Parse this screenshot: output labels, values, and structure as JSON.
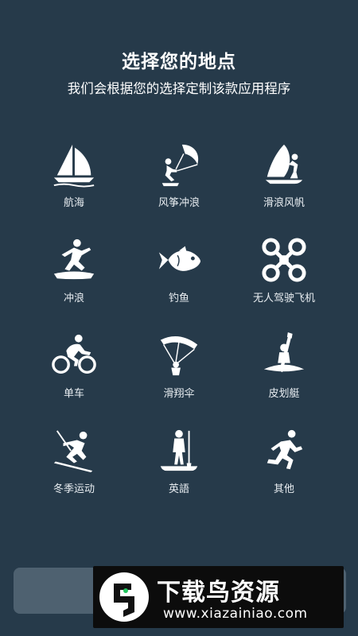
{
  "header": {
    "title": "选择您的地点",
    "subtitle": "我们会根据您的选择定制该款应用程序"
  },
  "activities": [
    {
      "label": "航海",
      "icon": "sailboat-icon"
    },
    {
      "label": "风筝冲浪",
      "icon": "kitesurf-icon"
    },
    {
      "label": "滑浪风帆",
      "icon": "windsurf-icon"
    },
    {
      "label": "冲浪",
      "icon": "surfer-icon"
    },
    {
      "label": "钓鱼",
      "icon": "fish-icon"
    },
    {
      "label": "无人驾驶飞机",
      "icon": "drone-icon"
    },
    {
      "label": "单车",
      "icon": "cyclist-icon"
    },
    {
      "label": "滑翔伞",
      "icon": "paraglider-icon"
    },
    {
      "label": "皮划艇",
      "icon": "kayak-icon"
    },
    {
      "label": "冬季运动",
      "icon": "skier-icon"
    },
    {
      "label": "英語",
      "icon": "paddleboard-icon"
    },
    {
      "label": "其他",
      "icon": "runner-icon"
    }
  ],
  "watermark": {
    "title": "下载鸟资源",
    "url": "www.xiazainiao.com"
  },
  "colors": {
    "background": "#263a4a",
    "button": "#4e6170",
    "icon": "#ffffff"
  }
}
